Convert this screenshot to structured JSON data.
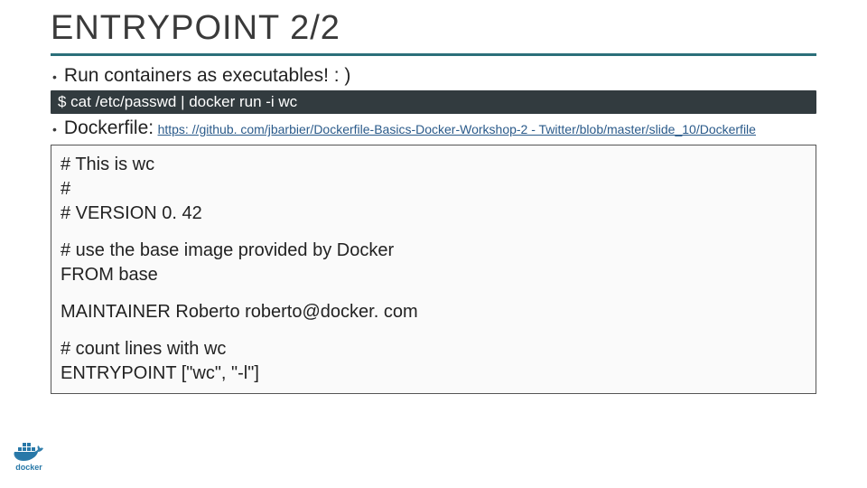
{
  "title": "ENTRYPOINT 2/2",
  "bullets": {
    "run": "Run containers as executables! : )",
    "dockerfile_label": "Dockerfile:",
    "link": "https: //github. com/jbarbier/Dockerfile-Basics-Docker-Workshop-2 - Twitter/blob/master/slide_10/Dockerfile"
  },
  "command": "$ cat /etc/passwd | docker run -i wc",
  "file": {
    "l1": "# This is wc",
    "l2": "#",
    "l3": "# VERSION 0. 42",
    "l4": "# use the base image provided by Docker",
    "l5": "FROM base",
    "l6": "MAINTAINER Roberto roberto@docker. com",
    "l7": "# count lines with wc",
    "l8": "ENTRYPOINT [\"wc\", \"-l\"]"
  },
  "logo_text": "docker"
}
